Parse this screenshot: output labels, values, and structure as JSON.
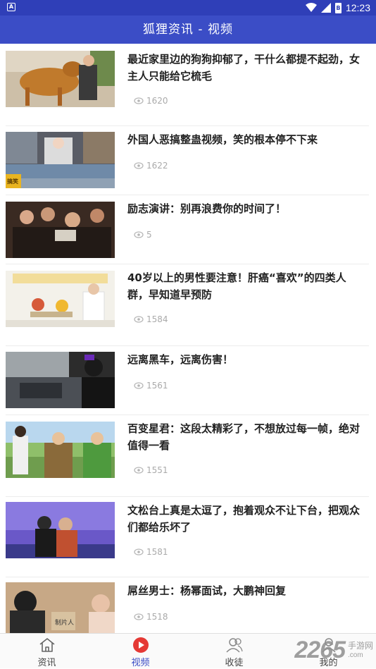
{
  "status_bar": {
    "time": "12:23",
    "app_badge": "A",
    "battery_label": "B"
  },
  "header": {
    "title": "狐狸资讯 - 视频"
  },
  "feed": [
    {
      "title": "最近家里边的狗狗抑郁了，干什么都提不起劲，女主人只能给它梳毛",
      "views": "1620"
    },
    {
      "title": "外国人恶搞整蛊视频，笑的根本停不下来",
      "views": "1622",
      "thumb_tag": "搞笑"
    },
    {
      "title": "励志演讲：别再浪费你的时间了！",
      "views": "5"
    },
    {
      "title": "40岁以上的男性要注意！肝癌“喜欢”的四类人群，早知道早预防",
      "views": "1584"
    },
    {
      "title": "远离黑车，远离伤害！",
      "views": "1561"
    },
    {
      "title": "百变星君：这段太精彩了，不想放过每一帧，绝对值得一看",
      "views": "1551"
    },
    {
      "title": "文松台上真是太逗了，抱着观众不让下台，把观众们都给乐坏了",
      "views": "1581"
    },
    {
      "title": "屌丝男士：杨幂面试，大鹏神回复",
      "views": "1518",
      "thumb_caption": "制片人"
    }
  ],
  "tabs": [
    {
      "label": "资讯",
      "icon": "home-icon"
    },
    {
      "label": "视频",
      "icon": "play-icon",
      "active": true
    },
    {
      "label": "收徒",
      "icon": "users-icon"
    },
    {
      "label": "我的",
      "icon": "user-icon"
    }
  ],
  "watermark": {
    "number": "2265",
    "site_name": "手游网",
    "url": ".com"
  },
  "colors": {
    "primary": "#3b4dc6",
    "status_bar": "#2f3fb8",
    "active_tab": "#e53935",
    "meta_text": "#aaaaaa"
  }
}
